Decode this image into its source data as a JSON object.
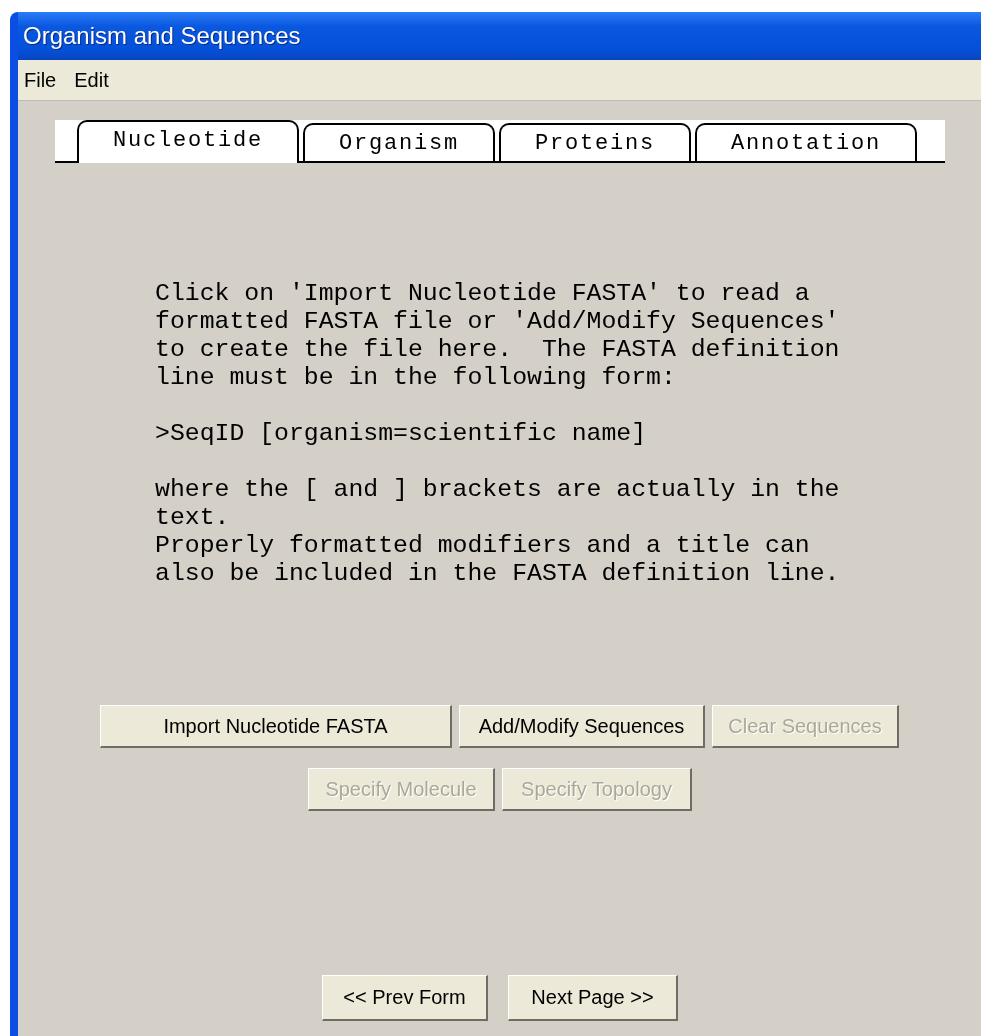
{
  "window": {
    "title": "Organism and Sequences"
  },
  "menu": [
    "File",
    "Edit"
  ],
  "tabs": [
    {
      "label": "Nucleotide",
      "selected": true
    },
    {
      "label": "Organism",
      "selected": false
    },
    {
      "label": "Proteins",
      "selected": false
    },
    {
      "label": "Annotation",
      "selected": false
    }
  ],
  "instructions": [
    "Click on 'Import Nucleotide FASTA' to read a\nformatted FASTA file or 'Add/Modify Sequences'\nto create the file here.  The FASTA definition\nline must be in the following form:",
    ">SeqID [organism=scientific name]",
    "where the [ and ] brackets are actually in the\ntext.\nProperly formatted modifiers and a title can\nalso be included in the FASTA definition line."
  ],
  "button_rows": [
    [
      {
        "label": "Import Nucleotide FASTA",
        "disabled": false
      },
      {
        "label": "Add/Modify Sequences",
        "disabled": false
      },
      {
        "label": "Clear Sequences",
        "disabled": true
      }
    ],
    [
      {
        "label": "Specify Molecule",
        "disabled": true
      },
      {
        "label": "Specify Topology",
        "disabled": true
      }
    ]
  ],
  "navigation": [
    {
      "label": "<< Prev Form",
      "disabled": false
    },
    {
      "label": "Next Page >>",
      "disabled": false
    }
  ]
}
